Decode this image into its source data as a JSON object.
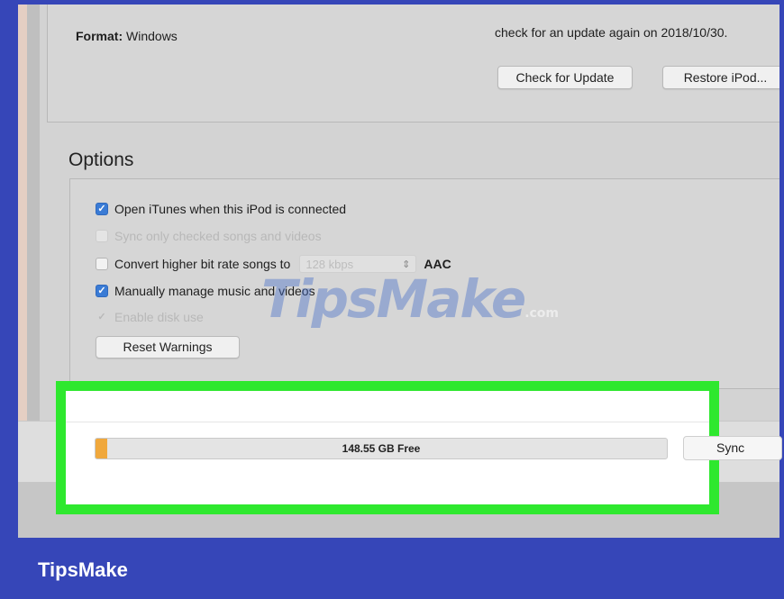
{
  "summary": {
    "format_label": "Format:",
    "format_value": "Windows",
    "update_note": "check for an update again on 2018/10/30.",
    "check_update_label": "Check for Update",
    "restore_label": "Restore iPod..."
  },
  "options": {
    "title": "Options",
    "items": [
      {
        "label": "Open iTunes when this iPod is connected",
        "state": "checked"
      },
      {
        "label": "Sync only checked songs and videos",
        "state": "disabled"
      },
      {
        "label": "Convert higher bit rate songs to",
        "state": "unchecked",
        "rate": "128 kbps",
        "format": "AAC"
      },
      {
        "label": "Manually manage music and videos",
        "state": "checked"
      },
      {
        "label": "Enable disk use",
        "state": "disabled-checked"
      }
    ],
    "reset_warnings_label": "Reset Warnings"
  },
  "capacity": {
    "label": "148.55 GB Free",
    "used_fraction": 0.02,
    "used_color": "#f0a83c"
  },
  "sync_label": "Sync",
  "highlight_color": "#2ee82e",
  "watermark": {
    "text": "TipsMake",
    "suffix": ".com"
  },
  "brand": "TipsMake"
}
